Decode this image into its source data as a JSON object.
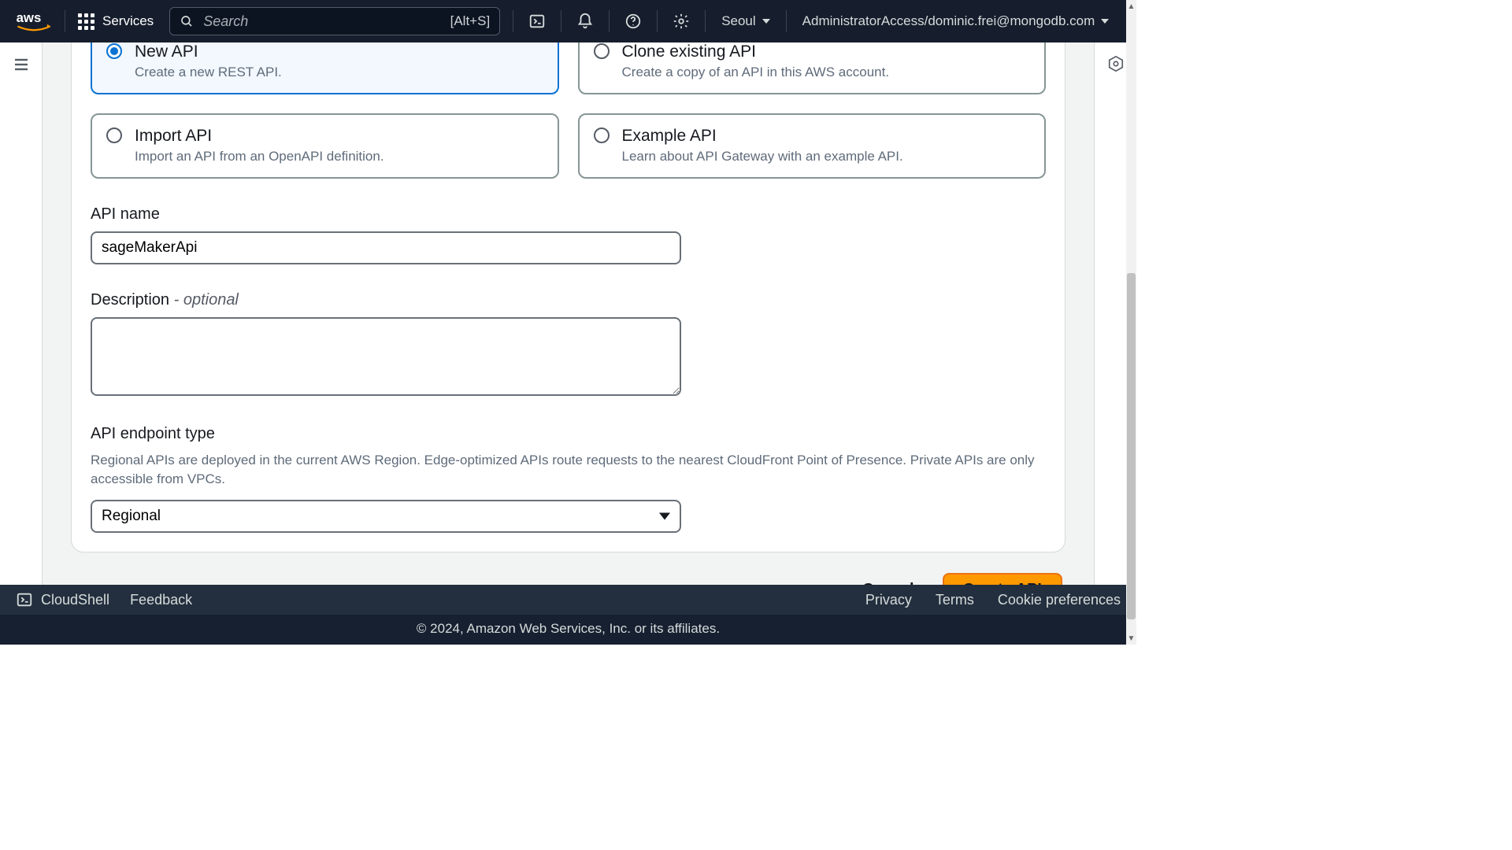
{
  "nav": {
    "services": "Services",
    "search_placeholder": "Search",
    "search_hint": "[Alt+S]",
    "region": "Seoul",
    "account": "AdministratorAccess/dominic.frei@mongodb.com"
  },
  "choices": {
    "new_api": {
      "title": "New API",
      "desc": "Create a new REST API."
    },
    "clone_api": {
      "title": "Clone existing API",
      "desc": "Create a copy of an API in this AWS account."
    },
    "import_api": {
      "title": "Import API",
      "desc": "Import an API from an OpenAPI definition."
    },
    "example_api": {
      "title": "Example API",
      "desc": "Learn about API Gateway with an example API."
    }
  },
  "form": {
    "api_name_label": "API name",
    "api_name_value": "sageMakerApi",
    "description_label": "Description",
    "description_optional": " - optional",
    "description_value": "",
    "endpoint_label": "API endpoint type",
    "endpoint_help": "Regional APIs are deployed in the current AWS Region. Edge-optimized APIs route requests to the nearest CloudFront Point of Presence. Private APIs are only accessible from VPCs.",
    "endpoint_value": "Regional"
  },
  "actions": {
    "cancel": "Cancel",
    "create": "Create API"
  },
  "footer": {
    "cloudshell": "CloudShell",
    "feedback": "Feedback",
    "privacy": "Privacy",
    "terms": "Terms",
    "cookies": "Cookie preferences",
    "copyright": "© 2024, Amazon Web Services, Inc. or its affiliates."
  }
}
